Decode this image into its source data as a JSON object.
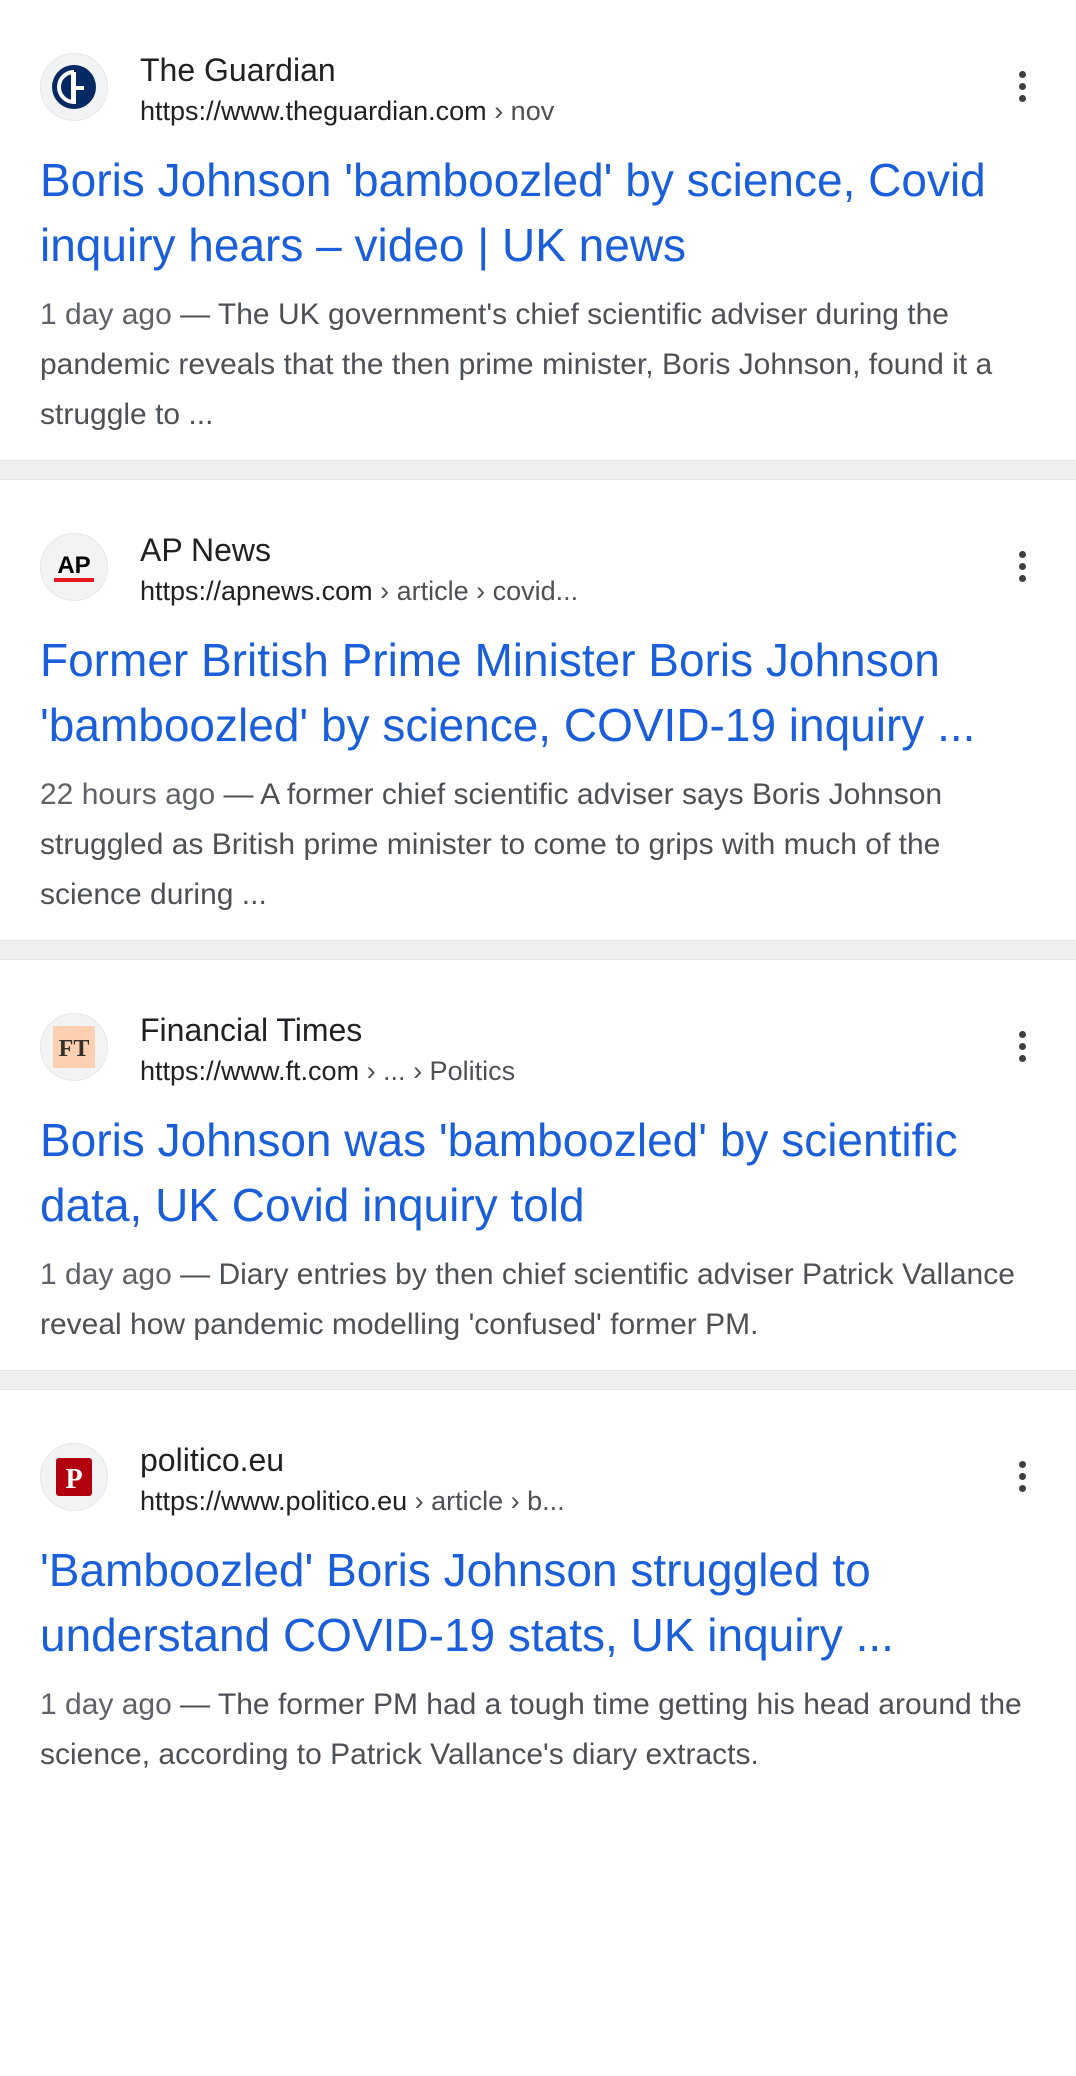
{
  "results": [
    {
      "source": "The Guardian",
      "url_domain": "https://www.theguardian.com",
      "url_path": " › nov",
      "favicon": "guardian-logo",
      "title": "Boris Johnson 'bamboozled' by science, Covid inquiry hears – video | UK news",
      "date": "1 day ago",
      "snippet": " — The UK government's chief scientific adviser during the pandemic reveals that the then prime minister, Boris Johnson, found it a struggle to ..."
    },
    {
      "source": "AP News",
      "url_domain": "https://apnews.com",
      "url_path": " › article › covid...",
      "favicon": "ap-logo",
      "title": "Former British Prime Minister Boris Johnson 'bamboozled' by science, COVID-19 inquiry ...",
      "date": "22 hours ago",
      "snippet": " — A former chief scientific adviser says Boris Johnson struggled as British prime minister to come to grips with much of the science during ..."
    },
    {
      "source": "Financial Times",
      "url_domain": "https://www.ft.com",
      "url_path": " › ... › Politics",
      "favicon": "ft-logo",
      "title": "Boris Johnson was 'bamboozled' by scientific data, UK Covid inquiry told",
      "date": "1 day ago",
      "snippet": " — Diary entries by then chief scientific adviser Patrick Vallance reveal how pandemic modelling 'confused' former PM."
    },
    {
      "source": "politico.eu",
      "url_domain": "https://www.politico.eu",
      "url_path": " › article › b...",
      "favicon": "politico-logo",
      "title": "'Bamboozled' Boris Johnson struggled to understand COVID-19 stats, UK inquiry ...",
      "date": "1 day ago",
      "snippet": " — The former PM had a tough time getting his head around the science, according to Patrick Vallance's diary extracts."
    }
  ],
  "logos": {
    "ap": "AP",
    "ft": "FT",
    "politico": "P"
  },
  "colors": {
    "title_link": "#1a5fd9",
    "guardian": "#052962",
    "ap_red": "#e4181e",
    "ft_bg": "#fcd0b1",
    "politico_red": "#b3000f"
  }
}
